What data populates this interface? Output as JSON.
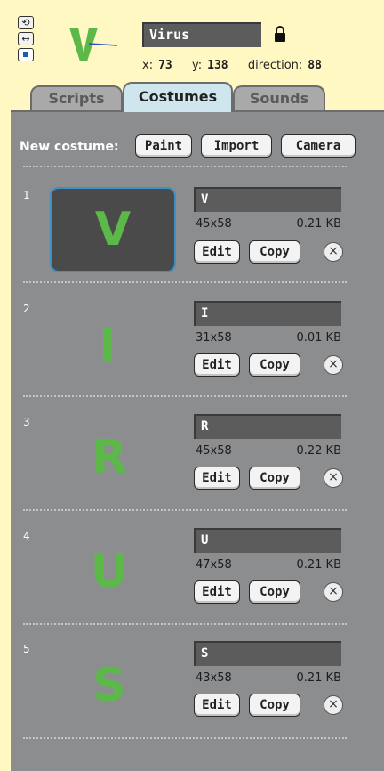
{
  "header": {
    "rotation_icons": [
      "rotate-icon",
      "flip-icon",
      "no-rotate-icon"
    ],
    "sprite_name": "Virus",
    "x_label": "x:",
    "x_value": "73",
    "y_label": "y:",
    "y_value": "138",
    "direction_label": "direction:",
    "direction_value": "88"
  },
  "tabs": [
    {
      "label": "Scripts",
      "active": false
    },
    {
      "label": "Costumes",
      "active": true
    },
    {
      "label": "Sounds",
      "active": false
    }
  ],
  "new_costume": {
    "label": "New costume:",
    "buttons": [
      "Paint",
      "Import",
      "Camera"
    ]
  },
  "costumes": [
    {
      "number": "1",
      "letter": "V",
      "name": "V",
      "size": "45x58",
      "filesize": "0.21 KB",
      "selected": true
    },
    {
      "number": "2",
      "letter": "I",
      "name": "I",
      "size": "31x58",
      "filesize": "0.01 KB",
      "selected": false
    },
    {
      "number": "3",
      "letter": "R",
      "name": "R",
      "size": "45x58",
      "filesize": "0.22 KB",
      "selected": false
    },
    {
      "number": "4",
      "letter": "U",
      "name": "U",
      "size": "47x58",
      "filesize": "0.21 KB",
      "selected": false
    },
    {
      "number": "5",
      "letter": "S",
      "name": "S",
      "size": "43x58",
      "filesize": "0.21 KB",
      "selected": false
    }
  ],
  "costume_buttons": {
    "edit": "Edit",
    "copy": "Copy",
    "delete": "×"
  },
  "colors": {
    "panel": "#8c8d8f",
    "accent": "#3d8fc4",
    "letter_green": "#5db84a",
    "background": "#fff8c2"
  }
}
